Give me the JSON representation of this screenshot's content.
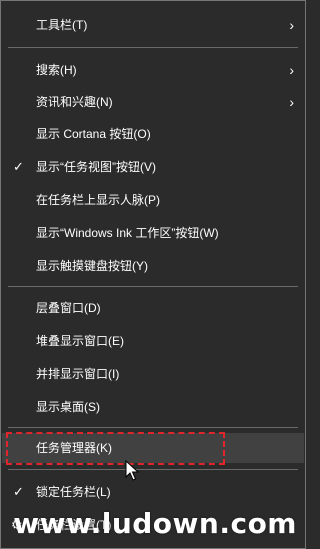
{
  "menu": {
    "items": [
      {
        "label": "工具栏(T)"
      },
      {
        "label": "搜索(H)"
      },
      {
        "label": "资讯和兴趣(N)"
      },
      {
        "label": "显示 Cortana 按钮(O)"
      },
      {
        "label": "显示“任务视图”按钮(V)"
      },
      {
        "label": "在任务栏上显示人脉(P)"
      },
      {
        "label": "显示“Windows Ink 工作区”按钮(W)"
      },
      {
        "label": "显示触摸键盘按钮(Y)"
      },
      {
        "label": "层叠窗口(D)"
      },
      {
        "label": "堆叠显示窗口(E)"
      },
      {
        "label": "并排显示窗口(I)"
      },
      {
        "label": "显示桌面(S)"
      },
      {
        "label": "任务管理器(K)"
      },
      {
        "label": "锁定任务栏(L)"
      },
      {
        "label": "任务栏设置(T)"
      }
    ]
  },
  "watermark": "www.ludown.com",
  "colors": {
    "background": "#2b2b2b",
    "hover": "#414141",
    "text": "#ffffff",
    "separator": "#6a6a6a",
    "highlight_border": "#e0262b"
  },
  "icons": {
    "check": "checkmark-icon",
    "submenu": "chevron-right-icon",
    "settings": "gear-icon",
    "cursor": "mouse-pointer-icon"
  }
}
